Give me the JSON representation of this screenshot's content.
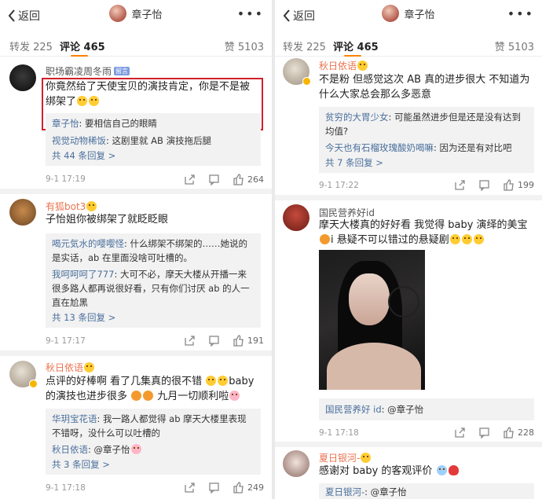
{
  "left": {
    "nav": {
      "back_label": "返回",
      "title": "章子怡"
    },
    "tabs": {
      "repost": "转发 225",
      "comments": "评论 465",
      "likes": "赞 5103"
    },
    "comments": [
      {
        "user": "职场霸凌周冬雨",
        "badge": "留言",
        "text": "你竟然给了天使宝贝的演技肯定，你是不是被绑架了",
        "replies": [
          {
            "name": "章子怡",
            "text": ": 要相信自己的眼睛"
          },
          {
            "name": "视觉动物稀饭",
            "text": ": 这剧里就 AB 演技拖后腿"
          }
        ],
        "more": "共 44 条回复 >",
        "time": "9-1 17:19",
        "likes": "264"
      },
      {
        "user": "有狐bot3",
        "text": "子怡姐你被绑架了就眨眨眼",
        "replies": [
          {
            "name": "喝元気水的嘤嘤怪",
            "text": ": 什么绑架不绑架的……她说的是实话，ab 在里面没啥可吐槽的。"
          },
          {
            "name": "我呵呵呵了777",
            "text": ": 大可不必，摩天大楼从开播一来很多路人都再说很好看，只有你们讨厌 ab 的人一直在尬黑"
          }
        ],
        "more": "共 13 条回复 >",
        "time": "9-1 17:17",
        "likes": "191"
      },
      {
        "user": "秋日依语",
        "text_a": "点评的好棒啊 看了几集真的很不错",
        "text_b": "baby 的演技也进步很多",
        "text_c": "九月一切顺利啦",
        "replies": [
          {
            "name": "华玥宝花语",
            "text": ": 我一路人都觉得 ab 摩天大楼里表现不错呀，没什么可以吐槽的"
          },
          {
            "name": "秋日依语",
            "text": ": @章子怡"
          }
        ],
        "more": "共 3 条回复 >",
        "time": "9-1 17:18",
        "likes": "249"
      }
    ]
  },
  "right": {
    "nav": {
      "back_label": "返回",
      "title": "章子怡"
    },
    "tabs": {
      "repost": "转发 225",
      "comments": "评论 465",
      "likes": "赞 5103"
    },
    "comments": [
      {
        "user": "秋日依语",
        "text": "不是粉 但感觉这次 AB 真的进步很大 不知道为什么大家总会那么多恶意",
        "replies": [
          {
            "name": "贫穷的大胃少女",
            "text": ": 可能虽然进步但是还是没有达到均值?"
          },
          {
            "name": "今天也有石榴玫瑰酸奶喝嘛",
            "text": ": 因为还是有对比吧"
          }
        ],
        "more": "共 7 条回复 >",
        "time": "9-1 17:22",
        "likes": "199"
      },
      {
        "user": "国民营养好id",
        "text": "摩天大楼真的好好看 我觉得 baby 演绎的美宝",
        "text_b": "i 悬疑不可以错过的悬疑剧",
        "replies": [
          {
            "name": "国民营养好 id",
            "text": ": @章子怡"
          }
        ],
        "time": "9-1 17:18",
        "likes": "228"
      },
      {
        "user": "夏日银河-",
        "text": "感谢对 baby 的客观评价",
        "replies": [
          {
            "name": "夏日银河-",
            "text": ": @章子怡"
          }
        ]
      }
    ]
  },
  "colors": {
    "accent": "#ff8200",
    "name": "#eb7350",
    "link": "#4a6f9c",
    "highlight_box": "#d0212b"
  },
  "icons": [
    "chevron-left-icon",
    "more-dots-icon",
    "share-icon",
    "comment-icon",
    "like-icon",
    "verified-badge-icon",
    "emoji-icon"
  ]
}
